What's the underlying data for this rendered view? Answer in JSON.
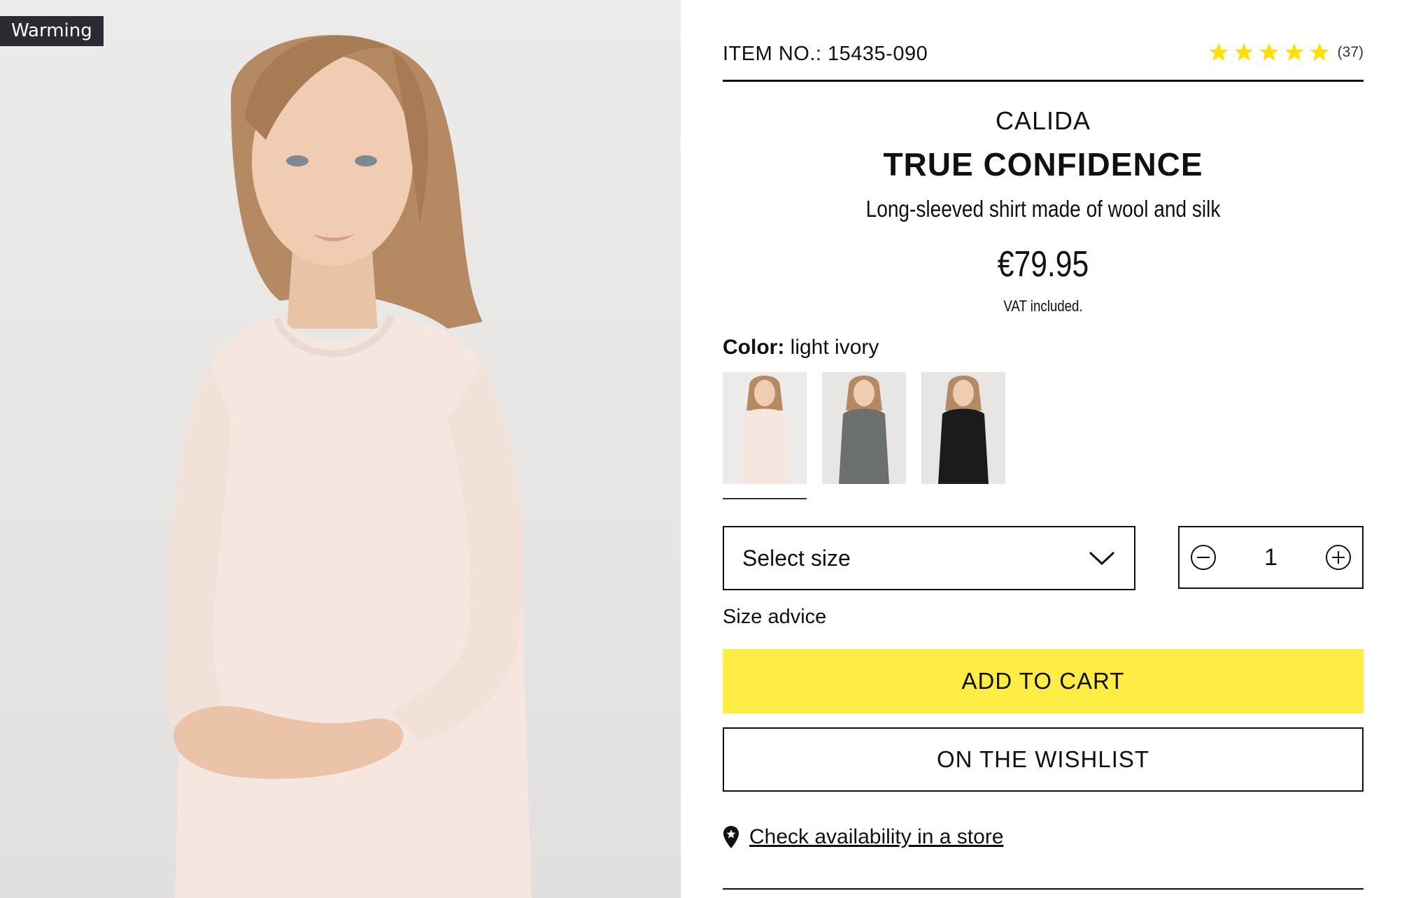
{
  "badge": "Warming",
  "item": {
    "label": "ITEM NO.:",
    "number": "15435-090"
  },
  "rating": {
    "stars": 5,
    "count": "(37)",
    "star_color": "#ffe000"
  },
  "product": {
    "brand": "CALIDA",
    "name": "TRUE CONFIDENCE",
    "description": "Long-sleeved shirt made of wool and silk",
    "price": "€79.95",
    "vat": "VAT included."
  },
  "color": {
    "label": "Color:",
    "selected": "light ivory",
    "swatches": [
      {
        "name": "light ivory",
        "hex": "#f3e6df",
        "selected": true
      },
      {
        "name": "grey",
        "hex": "#6c706c",
        "selected": false
      },
      {
        "name": "black",
        "hex": "#1b1b1d",
        "selected": false
      }
    ]
  },
  "size": {
    "placeholder": "Select size",
    "icon": "chevron-down-icon",
    "advice": "Size advice"
  },
  "quantity": {
    "value": "1",
    "minus_icon": "minus-circle-icon",
    "plus_icon": "plus-circle-icon"
  },
  "actions": {
    "add_to_cart": "ADD TO CART",
    "add_to_cart_color": "#ffec45",
    "wishlist": "ON THE WISHLIST",
    "store_link": "Check availability in a store",
    "store_icon": "map-pin-star-icon"
  }
}
